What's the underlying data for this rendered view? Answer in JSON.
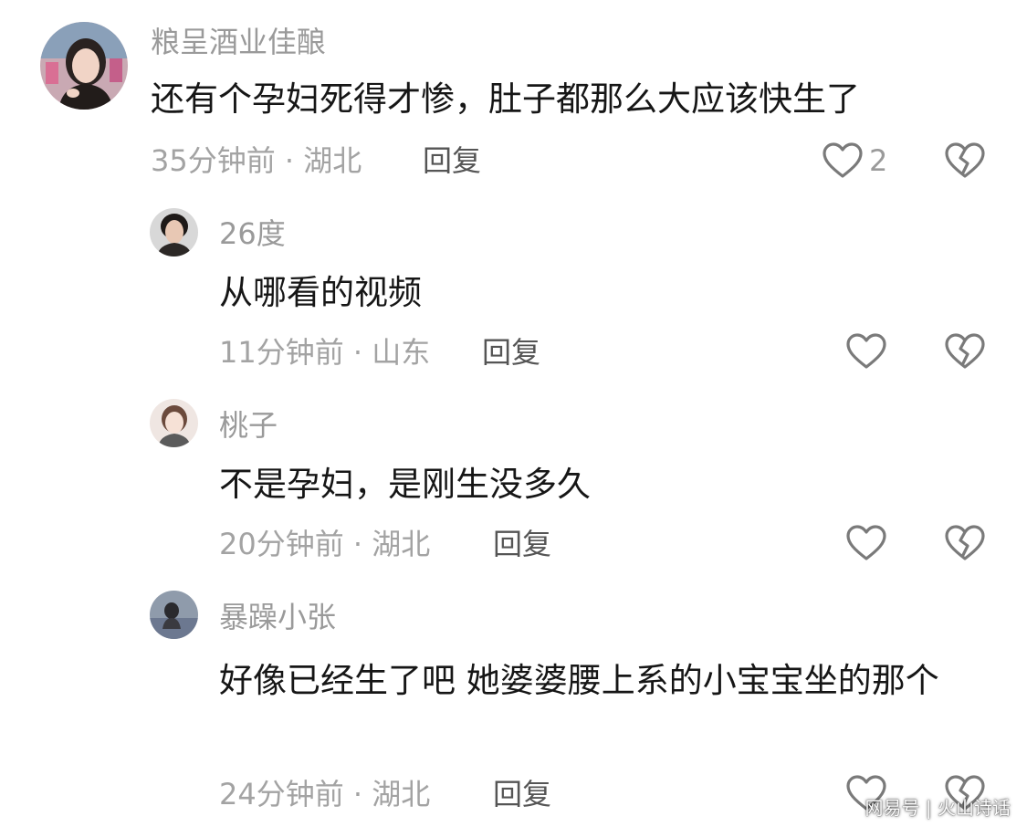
{
  "comments": [
    {
      "username": "粮呈酒业佳酿",
      "text": "还有个孕妇死得才惨，肚子都那么大应该快生了",
      "meta": "35分钟前 · 湖北",
      "reply_label": "回复",
      "like_count": "2",
      "like_icon": "heart-outline-icon",
      "dislike_icon": "broken-heart-icon"
    },
    {
      "username": "26度",
      "text": "从哪看的视频",
      "meta": "11分钟前 · 山东",
      "reply_label": "回复",
      "like_icon": "heart-outline-icon",
      "dislike_icon": "broken-heart-icon"
    },
    {
      "username": "桃子",
      "text": "不是孕妇，是刚生没多久",
      "meta": "20分钟前 · 湖北",
      "reply_label": "回复",
      "like_icon": "heart-outline-icon",
      "dislike_icon": "broken-heart-icon"
    },
    {
      "username": "暴躁小张",
      "text": "好像已经生了吧 她婆婆腰上系的小宝宝坐的那个",
      "meta": "24分钟前 · 湖北",
      "reply_label": "回复",
      "like_icon": "heart-outline-icon",
      "dislike_icon": "broken-heart-icon"
    }
  ],
  "watermark": "网易号 | 火山诗话",
  "colors": {
    "username": "#9a9a9a",
    "text": "#161616",
    "meta": "#a3a3a3",
    "reply": "#555555",
    "icon": "#7a7a7a"
  }
}
